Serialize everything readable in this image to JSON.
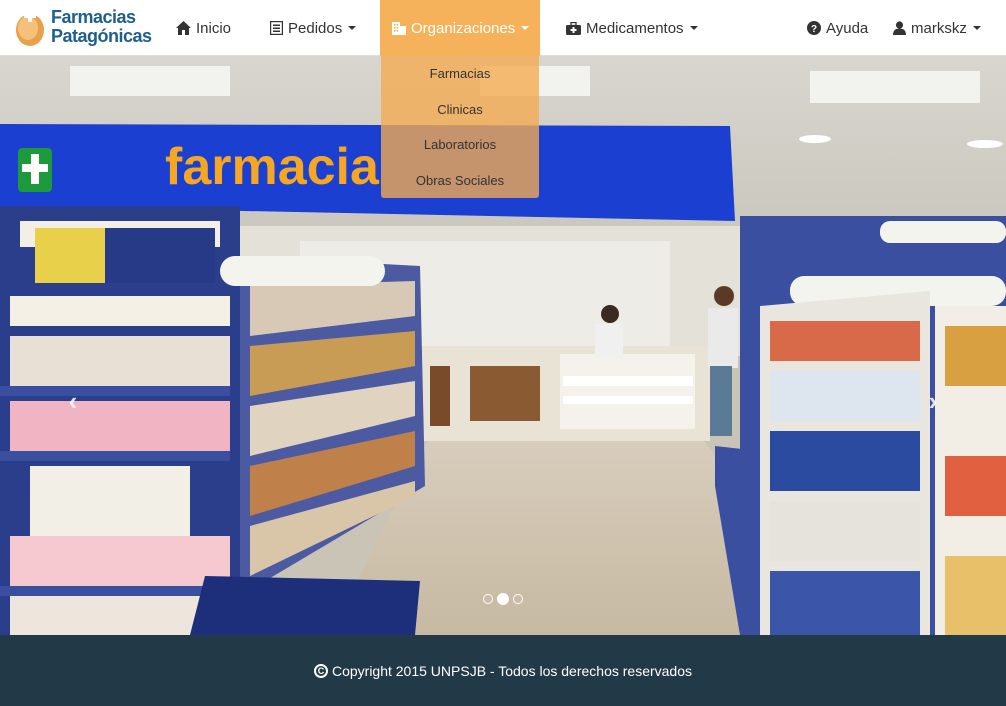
{
  "brand": {
    "line1": "Farmacias",
    "line2": "Patagónicas",
    "logo_icon": "pharmacy-logo-icon"
  },
  "nav": {
    "inicio": {
      "label": "Inicio",
      "icon": "home-icon"
    },
    "pedidos": {
      "label": "Pedidos",
      "icon": "list-icon"
    },
    "organizaciones": {
      "label": "Organizaciones",
      "icon": "building-icon"
    },
    "medicamentos": {
      "label": "Medicamentos",
      "icon": "medkit-icon"
    },
    "ayuda": {
      "label": "Ayuda",
      "icon": "question-circle-icon"
    },
    "user": {
      "label": "markskz",
      "icon": "user-icon"
    }
  },
  "dropdown": {
    "items": [
      {
        "label": "Farmacias"
      },
      {
        "label": "Clinicas"
      },
      {
        "label": "Laboratorios"
      },
      {
        "label": "Obras Sociales"
      }
    ]
  },
  "carousel": {
    "slides": 3,
    "active_slide": 2,
    "sign_text": "farmacia",
    "prev_icon": "chevron-left-icon",
    "next_icon": "chevron-right-icon"
  },
  "footer": {
    "text": "Copyright 2015 UNPSJB - Todos los derechos reservados",
    "icon": "copyright-icon"
  },
  "colors": {
    "accent": "#f5b25a",
    "footer_bg": "#223a48",
    "brand": "#1d5f8e"
  }
}
